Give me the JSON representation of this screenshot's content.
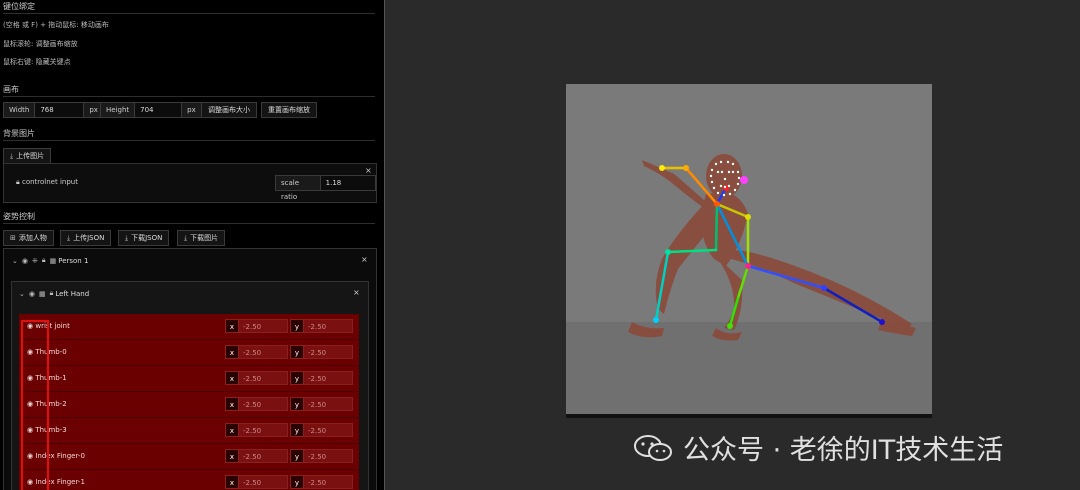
{
  "keybind": {
    "title": "键位绑定",
    "lines": [
      "(空格 或 F) + 拖动鼠标: 移动画布",
      "鼠标滚轮: 调整画布缩放",
      "鼠标右键: 隐藏关键点"
    ]
  },
  "canvas_section": {
    "title": "画布",
    "width_label": "Width",
    "width_value": "768",
    "width_unit": "px",
    "height_label": "Height",
    "height_value": "704",
    "height_unit": "px",
    "resize_button": "调整画布大小",
    "reset_zoom_button": "重置画布缩放"
  },
  "background": {
    "title": "背景图片",
    "upload_button": "上传图片",
    "controlnet_label": "controlnet input",
    "scale_label": "scale ratio",
    "scale_value": "1.18",
    "close": "×"
  },
  "pose": {
    "title": "姿势控制",
    "buttons": [
      "添加人物",
      "上传JSON",
      "下载JSON",
      "下载图片"
    ],
    "person_label": "Person 1",
    "hand_label": "Left Hand",
    "close": "×"
  },
  "joints": [
    {
      "name": "wrist joint",
      "x": "-2.50",
      "y": "-2.50"
    },
    {
      "name": "Thumb-0",
      "x": "-2.50",
      "y": "-2.50"
    },
    {
      "name": "Thumb-1",
      "x": "-2.50",
      "y": "-2.50"
    },
    {
      "name": "Thumb-2",
      "x": "-2.50",
      "y": "-2.50"
    },
    {
      "name": "Thumb-3",
      "x": "-2.50",
      "y": "-2.50"
    },
    {
      "name": "Index Finger-0",
      "x": "-2.50",
      "y": "-2.50"
    },
    {
      "name": "Index Finger-1",
      "x": "-2.50",
      "y": "-2.50"
    }
  ],
  "coord_labels": {
    "x": "x",
    "y": "y"
  },
  "watermark": "公众号 · 老徐的IT技术生活",
  "colors": {
    "accent_red": "#e01010",
    "joint_row": "#6a0000",
    "canvas_bg": "#7a7a7a"
  }
}
